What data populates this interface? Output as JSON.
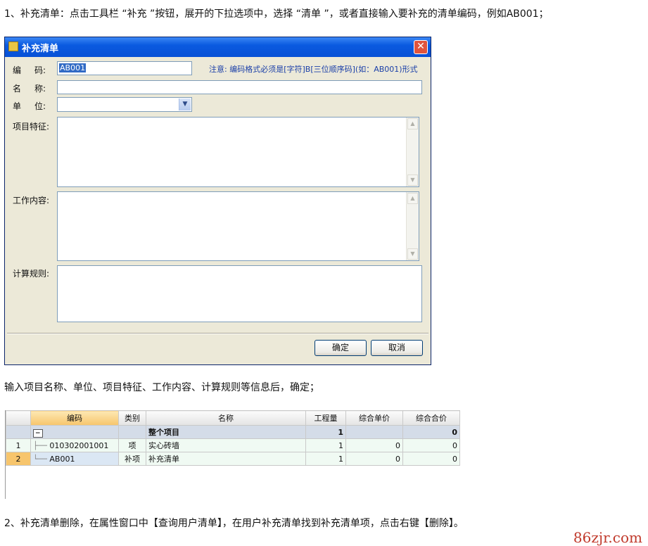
{
  "paragraphs": {
    "p1": "1、补充清单：点击工具栏 “补充 ”按钮，展开的下拉选项中，选择 “清单 ”，或者直接输入要补充的清单编码，例如AB001；",
    "p2": "输入项目名称、单位、项目特征、工作内容、计算规则等信息后，确定；",
    "p3": "2、补充清单删除，在属性窗口中【查询用户清单】，在用户补充清单找到补充清单项，点击右键【删除】。"
  },
  "watermark": "86zjr.com",
  "dialog": {
    "title": "补充清单",
    "close": "✕",
    "labels": {
      "code_a": "编",
      "code_b": "码:",
      "name_a": "名",
      "name_b": "称:",
      "unit_a": "单",
      "unit_b": "位:",
      "feature": "项目特征:",
      "work": "工作内容:",
      "rule": "计算规则:"
    },
    "code_value": "AB001",
    "note": "注意: 编码格式必须是[字符]B[三位顺序码](如：AB001)形式",
    "unit_value": "",
    "ok": "确定",
    "cancel": "取消"
  },
  "table": {
    "headers": [
      "",
      "编码",
      "类别",
      "名称",
      "工程量",
      "综合单价",
      "综合合价"
    ],
    "group": {
      "sign": "−",
      "name": "整个项目",
      "qty": "1",
      "total": "0"
    },
    "rows": [
      {
        "no": "1",
        "code": "010302001001",
        "type": "项",
        "name": "实心砖墙",
        "qty": "1",
        "price": "0",
        "total": "0"
      },
      {
        "no": "2",
        "code": "AB001",
        "type": "补项",
        "name": "补充清单",
        "qty": "1",
        "price": "0",
        "total": "0"
      }
    ]
  },
  "colors": {
    "accent_header": "#f7c56c",
    "title_bar": "#0a5ae0",
    "note": "#1a3fa8",
    "watermark": "#c0392b"
  }
}
